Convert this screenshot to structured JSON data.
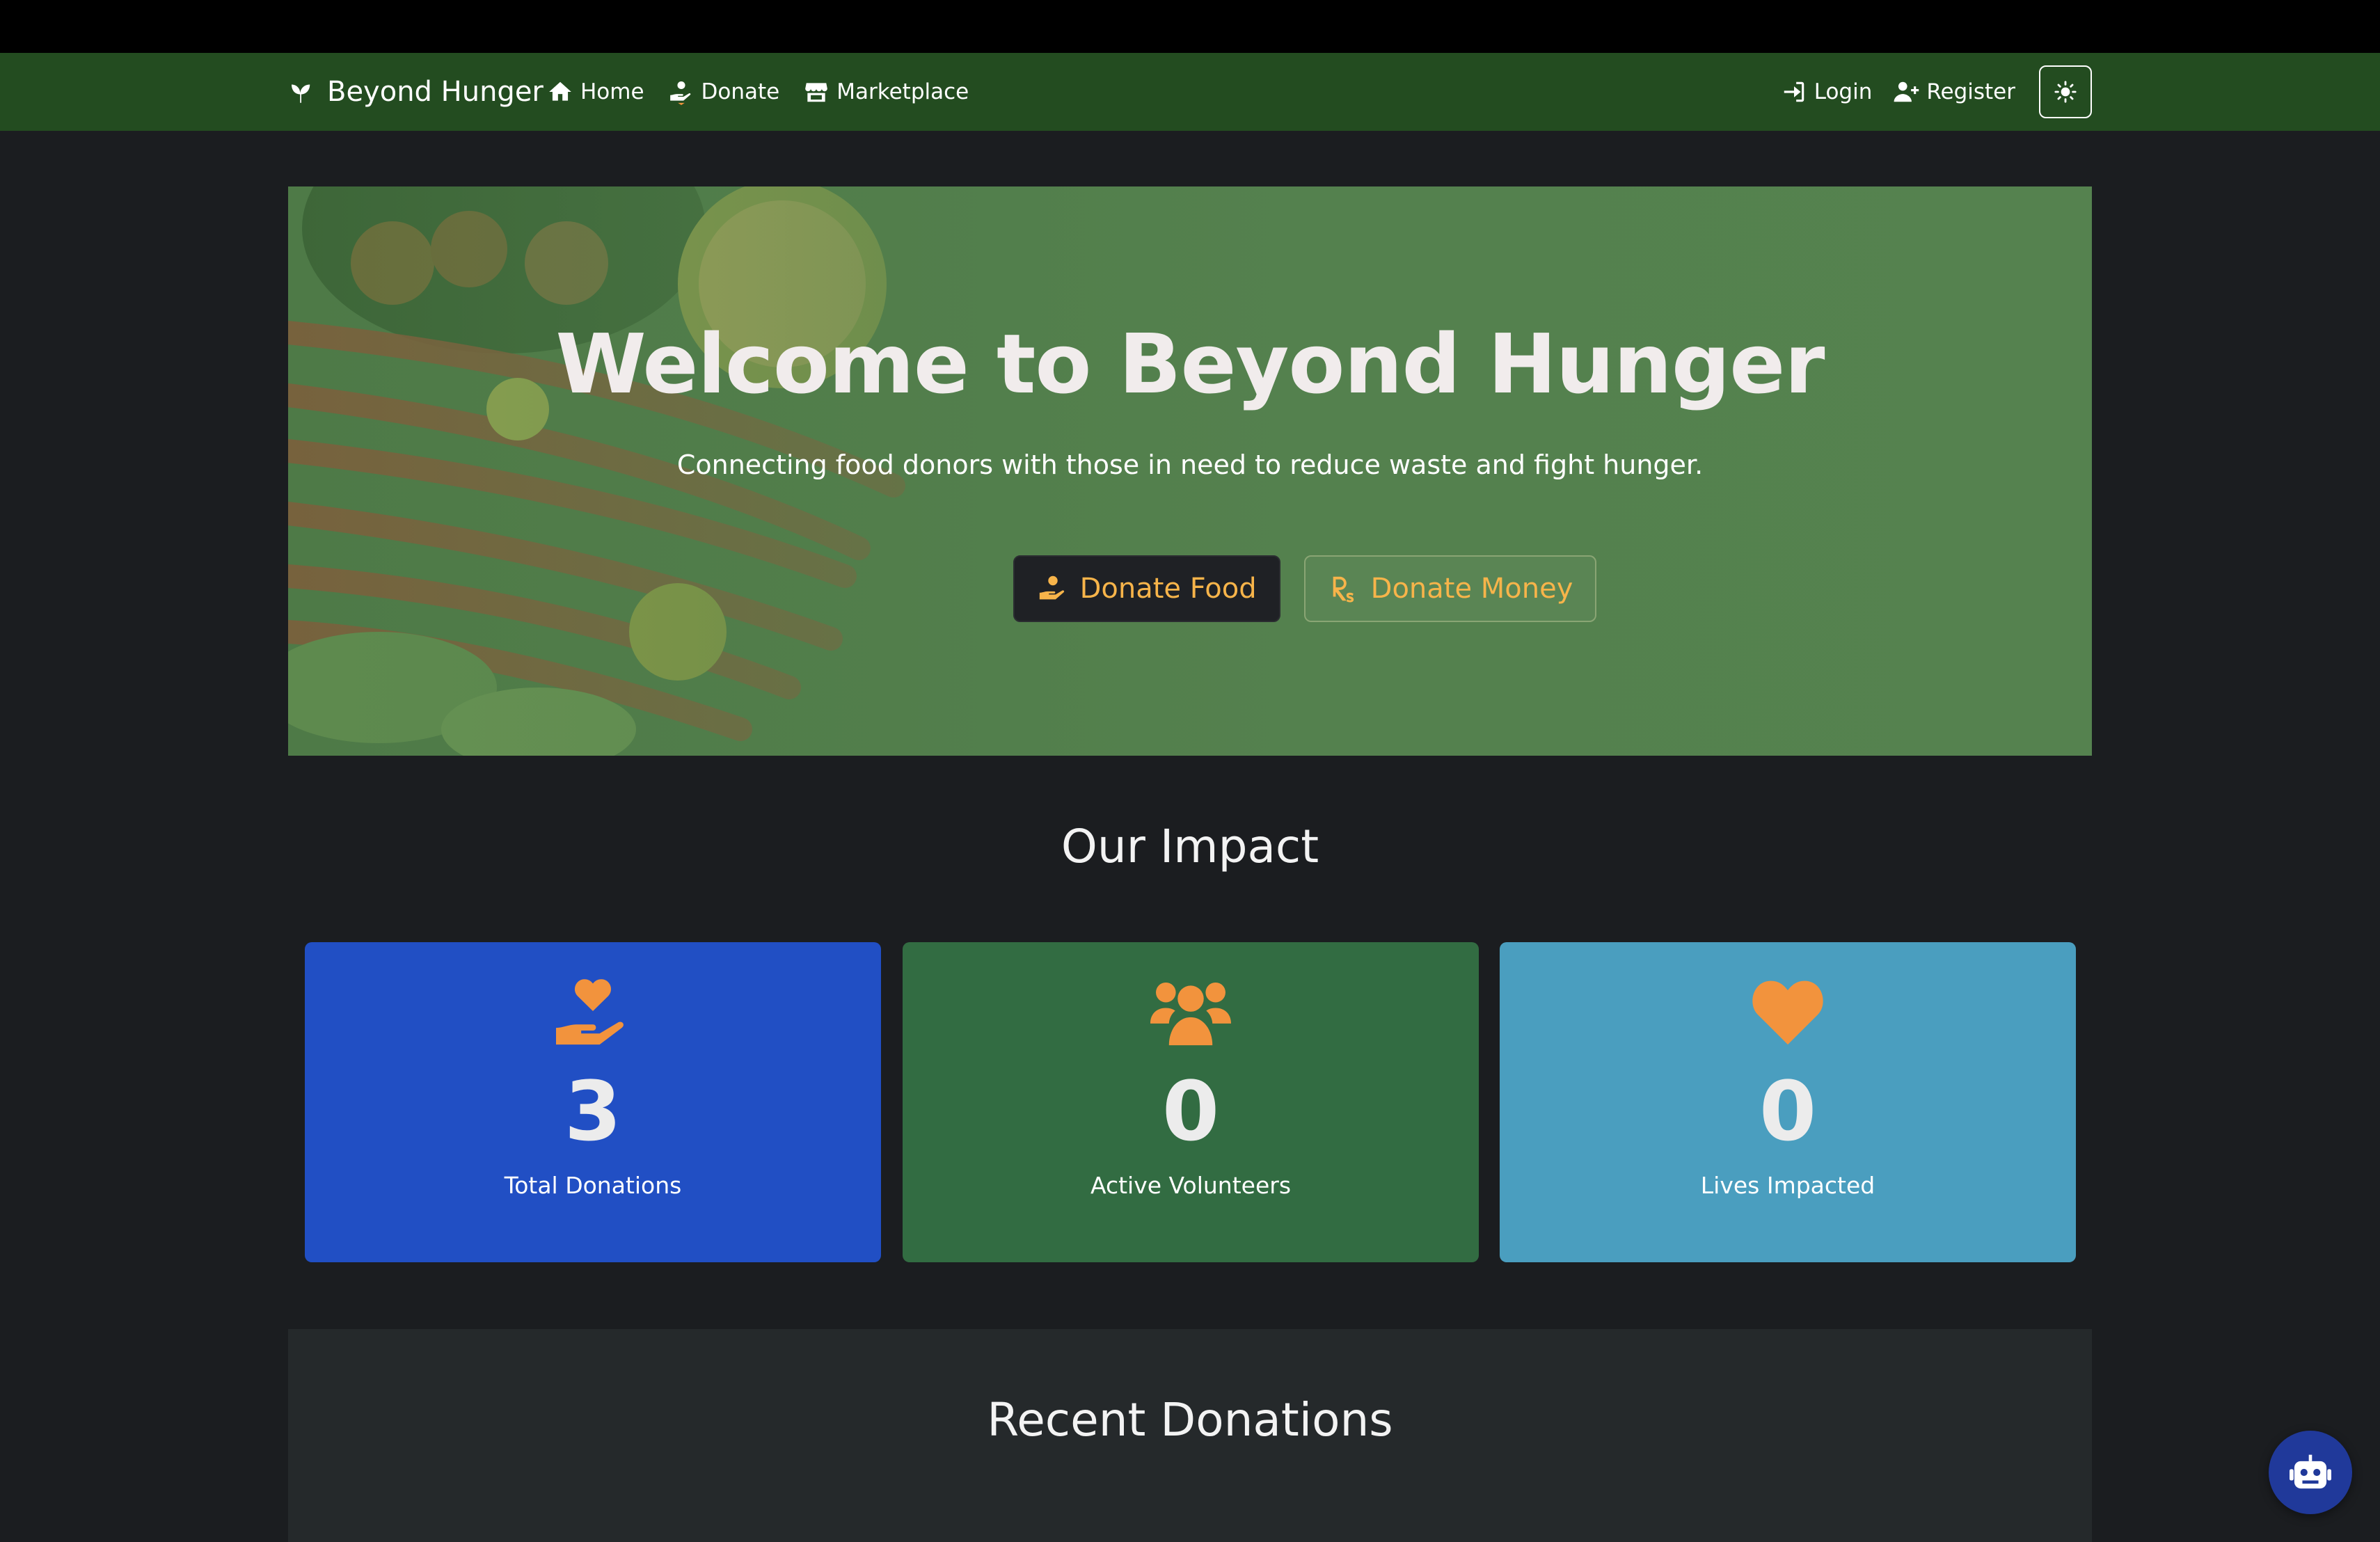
{
  "navbar": {
    "brand": "Beyond Hunger",
    "links": [
      {
        "label": "Home",
        "icon": "home-icon"
      },
      {
        "label": "Donate",
        "icon": "hand-holding-icon"
      },
      {
        "label": "Marketplace",
        "icon": "store-icon"
      }
    ],
    "login": "Login",
    "register": "Register",
    "theme_toggle_icon": "sun-icon"
  },
  "hero": {
    "title": "Welcome to Beyond Hunger",
    "subtitle": "Connecting food donors with those in need to reduce waste and fight hunger.",
    "donate_food": "Donate Food",
    "donate_money": "Donate Money"
  },
  "impact": {
    "title": "Our Impact",
    "stats": [
      {
        "value": "3",
        "label": "Total Donations",
        "icon": "hand-holding-heart-icon",
        "color": "#214fc4"
      },
      {
        "value": "0",
        "label": "Active Volunteers",
        "icon": "users-icon",
        "color": "#326c42"
      },
      {
        "value": "0",
        "label": "Lives Impacted",
        "icon": "heart-icon",
        "color": "#4a9ebf"
      }
    ]
  },
  "recent": {
    "title": "Recent Donations"
  },
  "colors": {
    "navbar": "#234c20",
    "accent": "#f2933d",
    "button_text": "#f7b44a"
  }
}
